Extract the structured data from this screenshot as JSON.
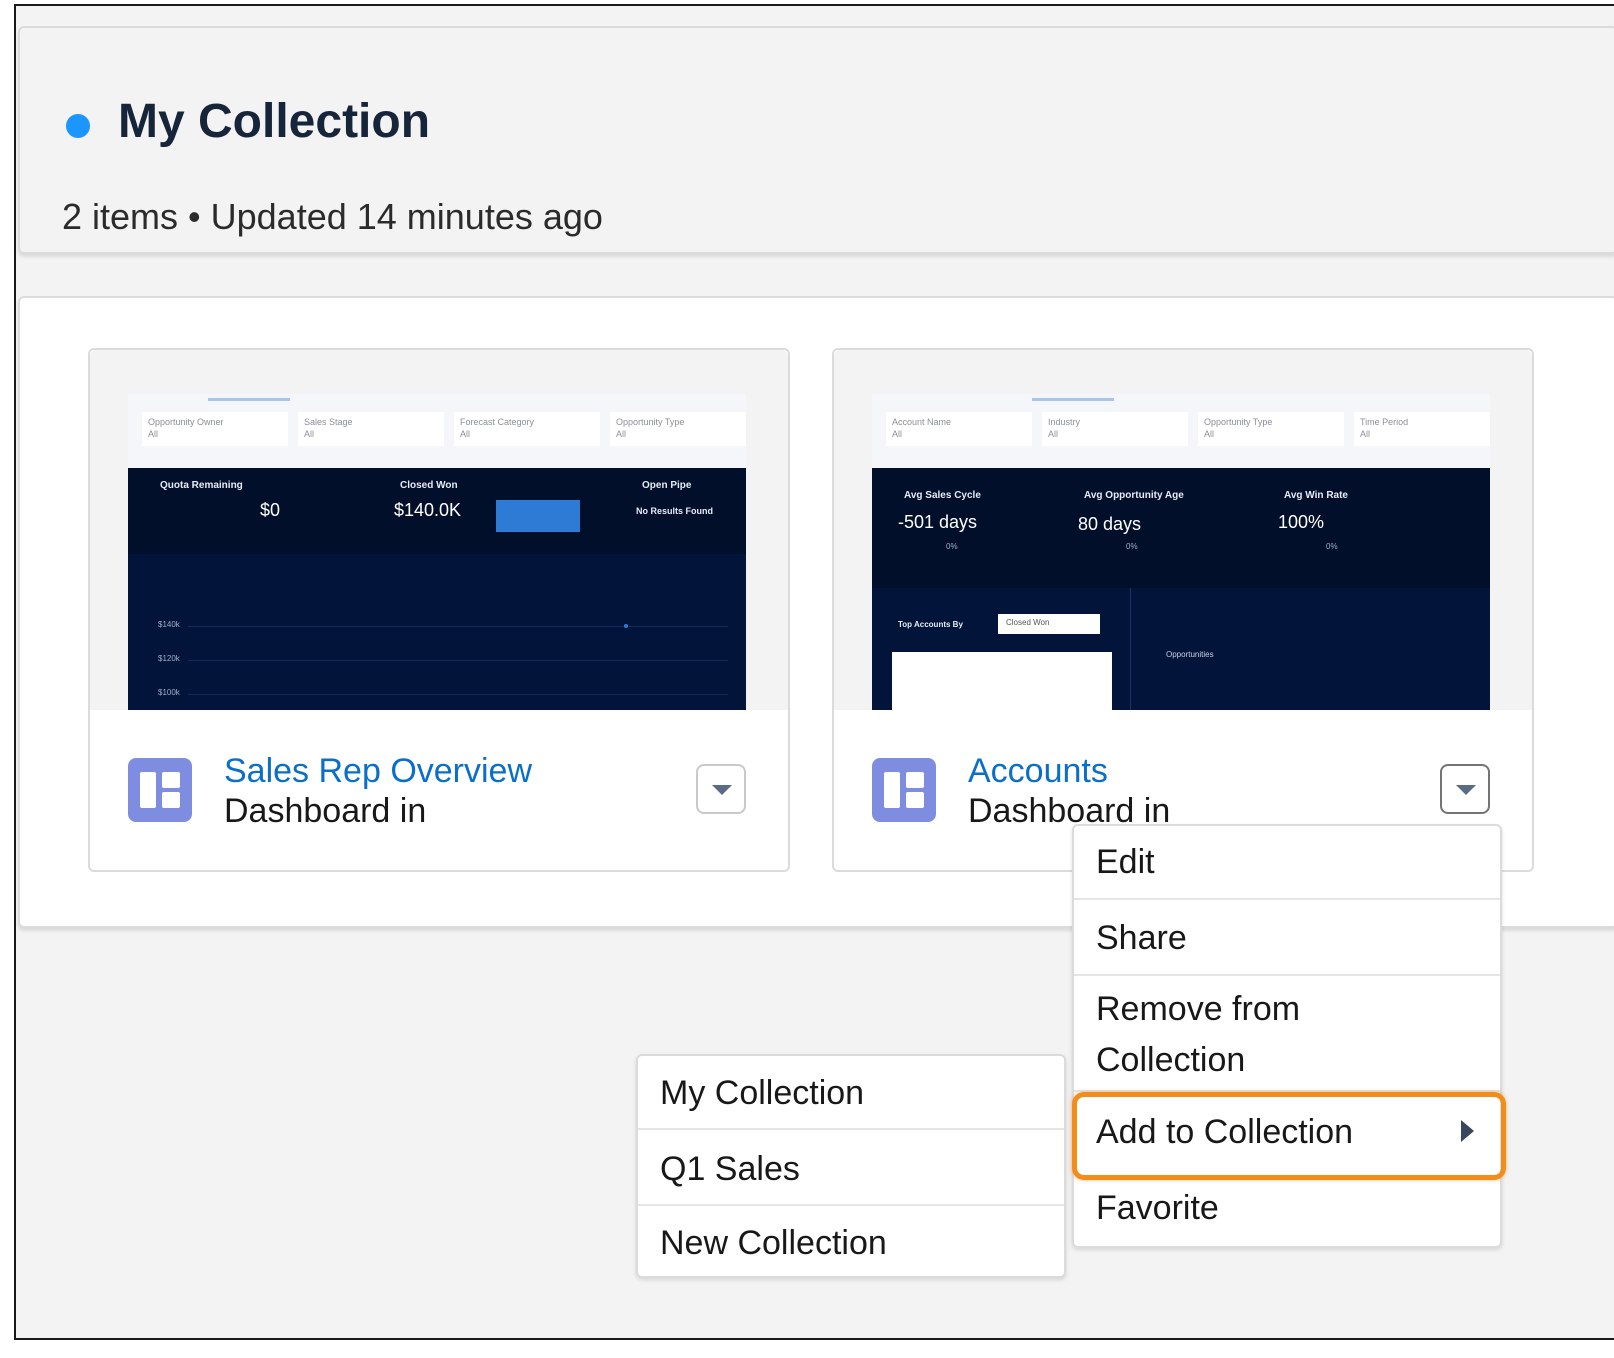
{
  "collection": {
    "title": "My Collection",
    "meta": "2 items • Updated 14 minutes ago"
  },
  "cards": [
    {
      "name": "Sales Rep Overview",
      "subtitle": "Dashboard in",
      "thumbnail": {
        "filters": [
          {
            "label": "Opportunity Owner",
            "value": "All"
          },
          {
            "label": "Sales Stage",
            "value": "All"
          },
          {
            "label": "Forecast Category",
            "value": "All"
          },
          {
            "label": "Opportunity Type",
            "value": "All"
          }
        ],
        "kpis": [
          {
            "label": "Quota Remaining",
            "value": "$0"
          },
          {
            "label": "Closed Won",
            "value": "$140.0K"
          },
          {
            "label": "Open Pipe",
            "value": "No Results Found"
          }
        ],
        "axis": [
          "$140k",
          "$120k",
          "$100k"
        ]
      }
    },
    {
      "name": "Accounts",
      "subtitle": "Dashboard in",
      "thumbnail": {
        "filters": [
          {
            "label": "Account Name",
            "value": "All"
          },
          {
            "label": "Industry",
            "value": "All"
          },
          {
            "label": "Opportunity Type",
            "value": "All"
          },
          {
            "label": "Time Period",
            "value": "All"
          }
        ],
        "kpis": [
          {
            "label": "Avg Sales Cycle",
            "value": "-501 days",
            "delta": "0%"
          },
          {
            "label": "Avg Opportunity Age",
            "value": "80 days",
            "delta": "0%"
          },
          {
            "label": "Avg Win Rate",
            "value": "100%",
            "delta": "0%"
          }
        ],
        "top_accounts_label": "Top Accounts By",
        "top_accounts_select": "Closed Won",
        "opportunities_label": "Opportunities"
      }
    }
  ],
  "context_menu": {
    "items": [
      "Edit",
      "Share",
      "Remove from Collection",
      "Add to Collection",
      "Favorite"
    ]
  },
  "submenu": {
    "items": [
      "My Collection",
      "Q1 Sales",
      "New Collection"
    ]
  },
  "colors": {
    "accent_dot": "#1b96ff",
    "link": "#0b6fc9",
    "highlight": "#f28c1b",
    "dashboard_icon": "#7f8de1"
  },
  "icons": {
    "dashboard": "dashboard-icon",
    "dropdown": "chevron-down-icon",
    "submenu": "chevron-right-icon"
  }
}
